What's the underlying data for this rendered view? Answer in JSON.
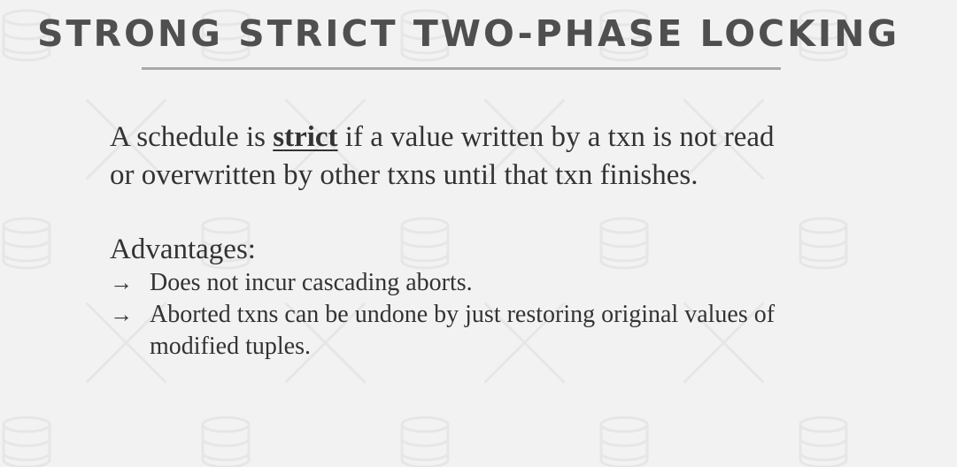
{
  "slide": {
    "title": "STRONG STRICT TWO-PHASE LOCKING",
    "definition": {
      "prefix": "A schedule is ",
      "term": "strict",
      "suffix": " if a value written by a txn is not read or overwritten by other txns until that txn finishes."
    },
    "advantages": {
      "heading": "Advantages:",
      "bullet_icon": "right-arrow",
      "items": [
        "Does not incur cascading aborts.",
        "Aborted txns can be undone by just restoring original values of modified tuples."
      ]
    }
  },
  "colors": {
    "background": "#f2f2f2",
    "title": "#4f4f4f",
    "body_text": "#333333",
    "rule": "#a9a9a9"
  }
}
